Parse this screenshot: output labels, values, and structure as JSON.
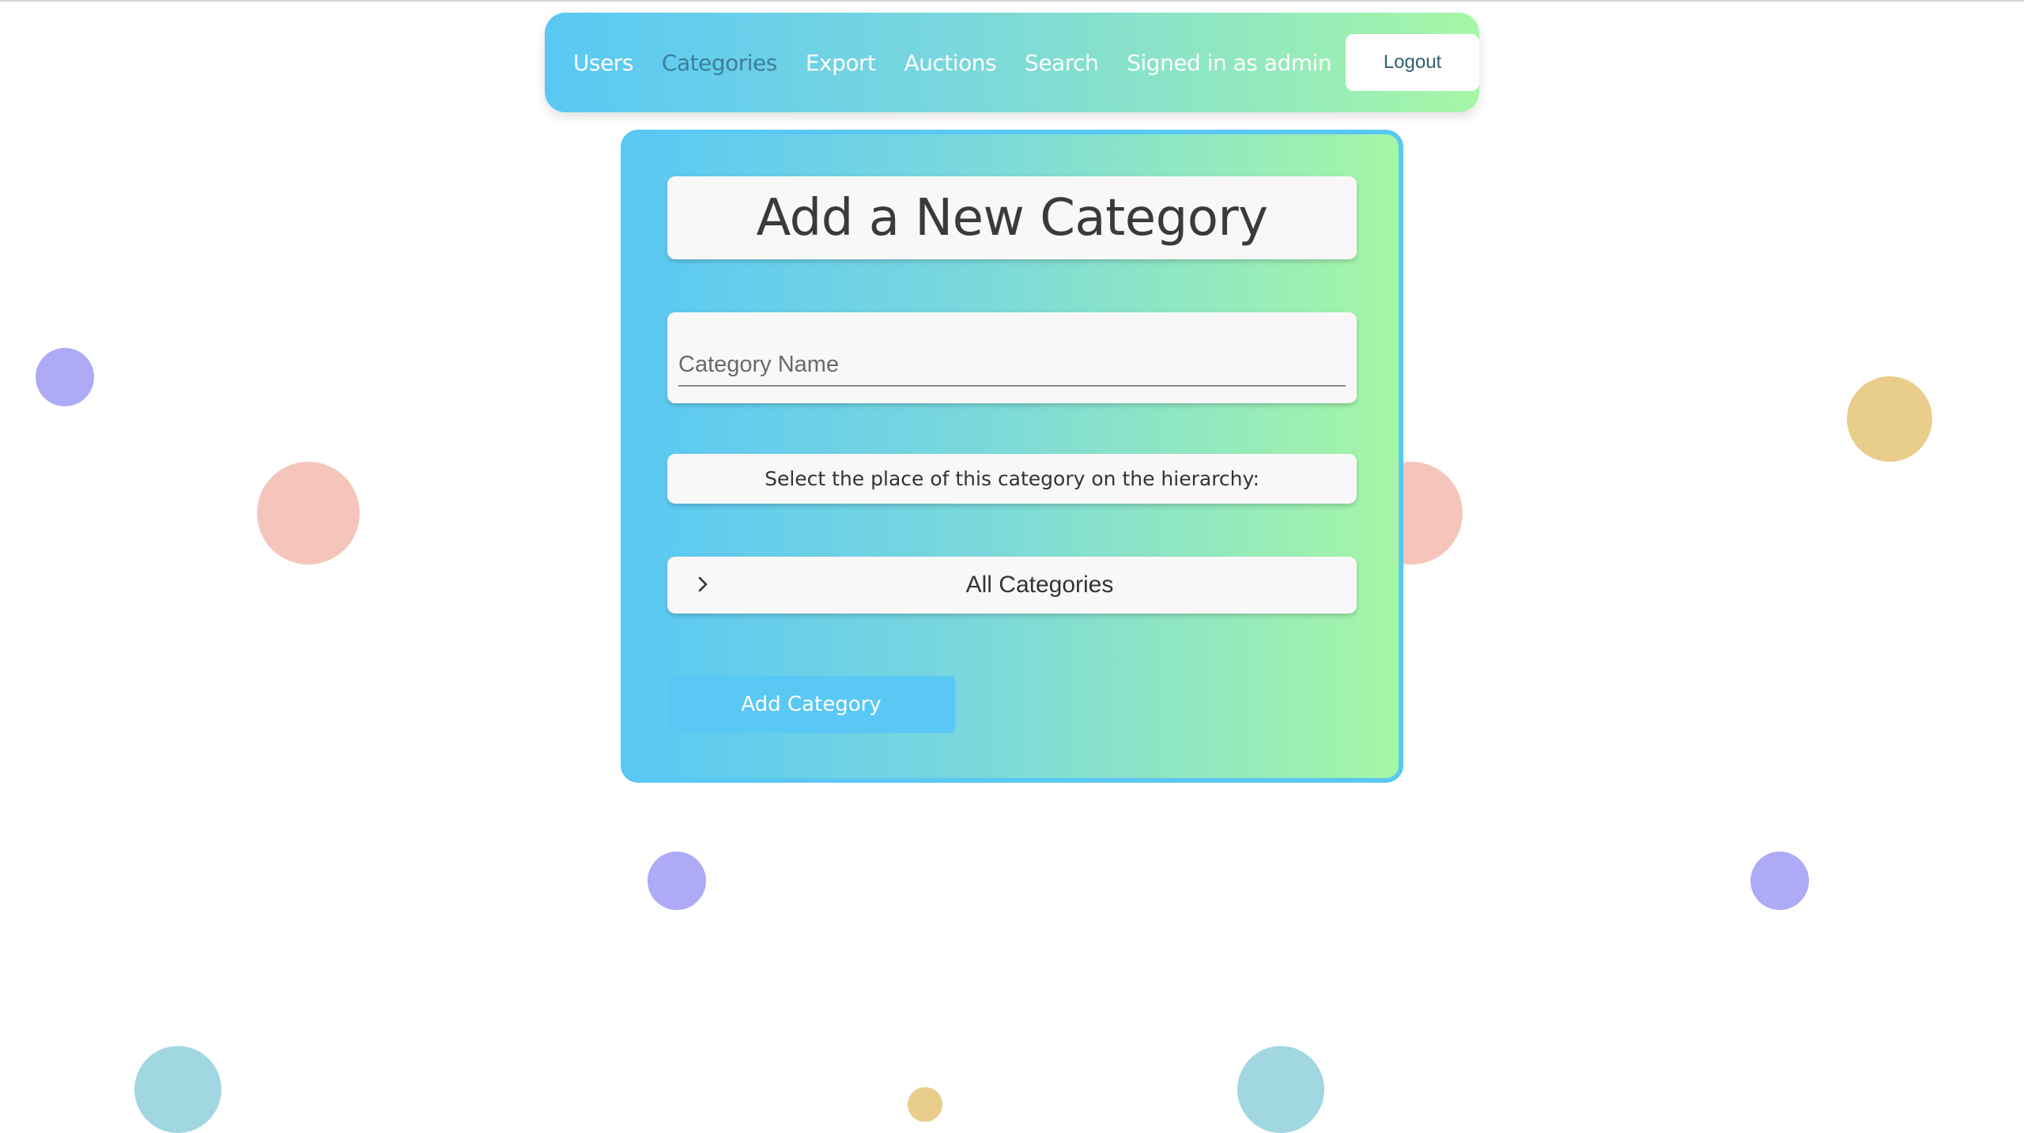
{
  "navbar": {
    "links": [
      {
        "label": "Users",
        "active": false
      },
      {
        "label": "Categories",
        "active": true
      },
      {
        "label": "Export",
        "active": false
      },
      {
        "label": "Auctions",
        "active": false
      },
      {
        "label": "Search",
        "active": false
      }
    ],
    "signed_in_text": "Signed in as admin",
    "logout_label": "Logout"
  },
  "form": {
    "title": "Add a New Category",
    "category_name_placeholder": "Category Name",
    "category_name_value": "",
    "hierarchy_hint": "Select the place of this category on the hierarchy:",
    "tree_root_label": "All Categories",
    "tree_root_icon": "chevron-right-icon",
    "submit_label": "Add Category"
  },
  "colors": {
    "gradient_start": "#5ac8f5",
    "gradient_end": "#a6f6a6",
    "active_link": "#3d7f9a"
  }
}
